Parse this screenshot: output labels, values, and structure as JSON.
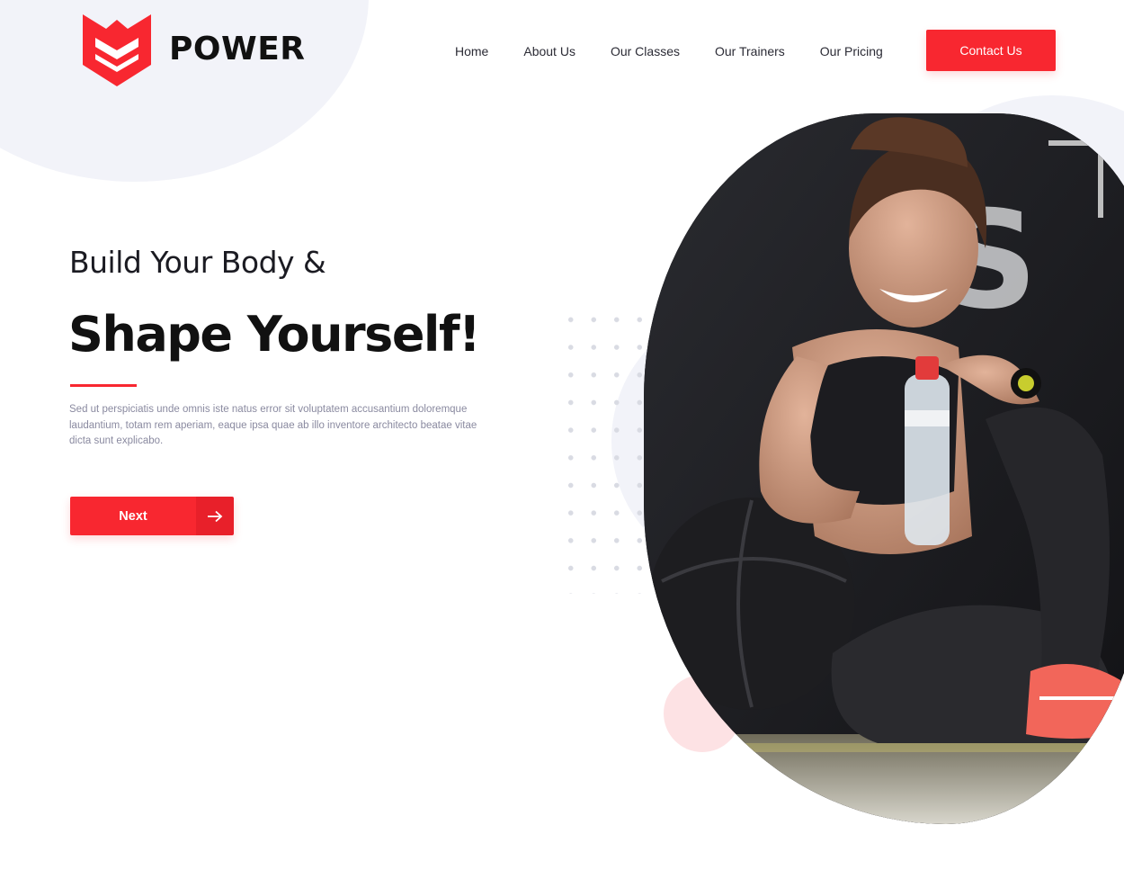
{
  "brand": {
    "name": "POWER",
    "logo_icon": "shield-logo-icon",
    "accent_color": "#f82730"
  },
  "nav": {
    "items": [
      {
        "label": "Home"
      },
      {
        "label": "About Us"
      },
      {
        "label": "Our Classes"
      },
      {
        "label": "Our Trainers"
      },
      {
        "label": "Our Pricing"
      }
    ],
    "cta_label": "Contact Us"
  },
  "hero": {
    "subtitle": "Build Your Body &",
    "title": "Shape Yourself!",
    "description": "Sed ut perspiciatis unde omnis iste natus error sit voluptatem accusantium doloremque laudantium, totam rem aperiam, eaque ipsa quae ab illo inventore architecto beatae vitae dicta sunt explicabo.",
    "next_label": "Next",
    "next_icon": "arrow-right-icon",
    "image_icon": "woman-athlete-photo"
  }
}
